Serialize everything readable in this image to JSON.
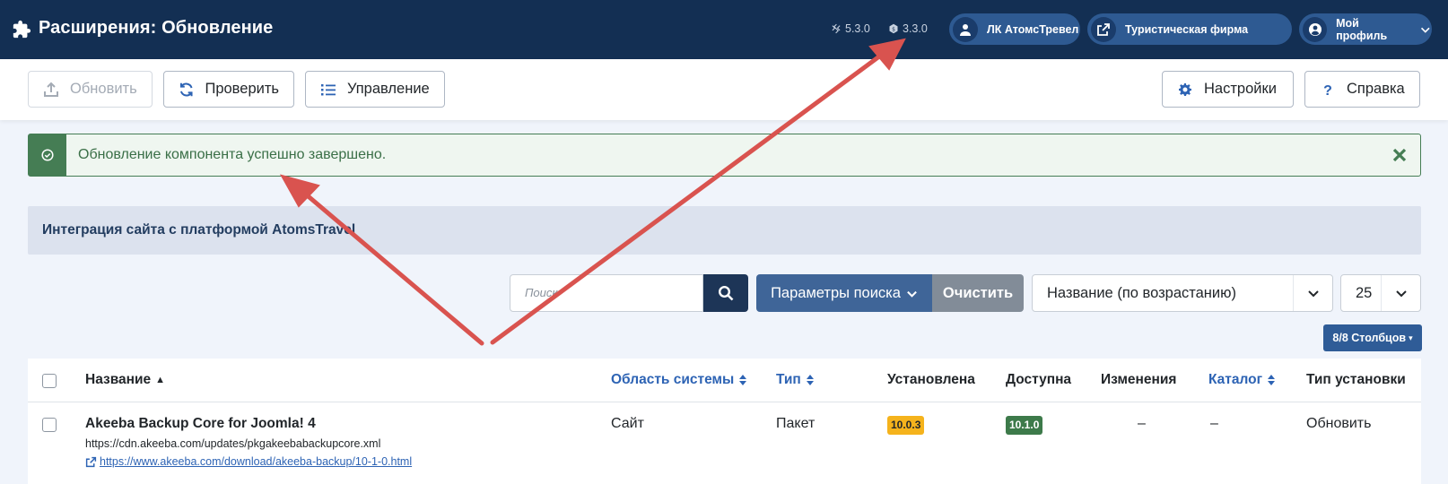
{
  "header": {
    "title": "Расширения: Обновление",
    "joomla_version": "5.3.0",
    "component_version": "3.3.0",
    "buttons": [
      {
        "label": "ЛК АтомсТревел",
        "icon": "user-icon"
      },
      {
        "label": "Туристическая фирма",
        "icon": "external-link-icon"
      },
      {
        "label": "Мой профиль",
        "icon": "user-circle-icon"
      }
    ]
  },
  "toolbar": {
    "update_label": "Обновить",
    "check_label": "Проверить",
    "manage_label": "Управление",
    "settings_label": "Настройки",
    "help_label": "Справка"
  },
  "alert": {
    "message": "Обновление компонента успешно завершено."
  },
  "info": {
    "text": "Интеграция сайта с платформой AtomsTravel"
  },
  "filters": {
    "search_placeholder": "Поиск",
    "search_options_label": "Параметры поиска",
    "clear_label": "Очистить",
    "sort_value": "Название (по возрастанию)",
    "limit_value": "25",
    "columns_label": "8/8 Столбцов"
  },
  "table": {
    "columns": [
      "Название",
      "Область системы",
      "Тип",
      "Установлена",
      "Доступна",
      "Изменения",
      "Каталог",
      "Тип установки"
    ],
    "rows": [
      {
        "name": "Akeeba Backup Core for Joomla! 4",
        "update_url": "https://cdn.akeeba.com/updates/pkgakeebabackupcore.xml",
        "download_url": "https://www.akeeba.com/download/akeeba-backup/10-1-0.html",
        "area": "Сайт",
        "type": "Пакет",
        "installed": "10.0.3",
        "available": "10.1.0",
        "changes": "–",
        "catalog": "–",
        "install_type": "Обновить"
      }
    ]
  },
  "colors": {
    "header_bg": "#132f53",
    "success": "#457d54",
    "arrow": "#d9534f",
    "link": "#2d63b4"
  }
}
